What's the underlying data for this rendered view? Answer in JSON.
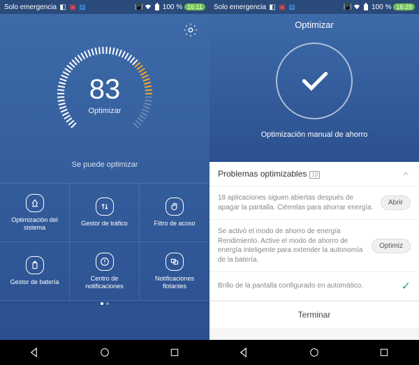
{
  "status": {
    "carrier": "Solo emergencia",
    "battery": "100 %",
    "time1": "16:11",
    "time2": "16:29"
  },
  "screen1": {
    "score": "83",
    "score_label": "Optimizar",
    "subtext": "Se puede optimizar",
    "tiles": [
      "Optimización del sistema",
      "Gestor de tráfico",
      "Filtro de acoso",
      "Gestor de batería",
      "Centro de notificaciones",
      "Notificaciones flotantes"
    ]
  },
  "screen2": {
    "title": "Optimizar",
    "subtitle": "Optimización manual de ahorro",
    "section_header": "Problemas optimizables",
    "section_count": "10",
    "items": [
      {
        "text": "18 aplicaciones siguen abiertas después de apagar la pantalla. Ciérrelas para ahorrar energía.",
        "btn": "Abrir"
      },
      {
        "text": "Se activó el modo de ahorro de energía Rendimiento. Active el modo de ahorro de energía inteligente para extender la autonomía de la batería.",
        "btn": "Optimiz"
      },
      {
        "text": "Brillo de la pantalla configurado en automático.",
        "done": true
      }
    ],
    "finish": "Terminar"
  }
}
